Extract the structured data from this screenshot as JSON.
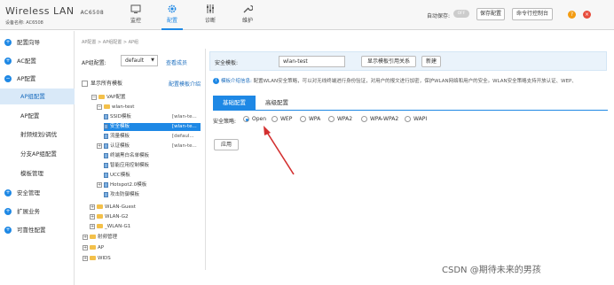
{
  "header": {
    "title": "Wireless",
    "title_lan": "LAN",
    "model": "AC6508",
    "device_label": "设备名称:",
    "device_name": "AC6508",
    "nav": [
      {
        "label": "监控",
        "icon": "monitor-icon",
        "active": false
      },
      {
        "label": "配置",
        "icon": "gear-icon",
        "active": true
      },
      {
        "label": "诊断",
        "icon": "sliders-icon",
        "active": false
      },
      {
        "label": "维护",
        "icon": "wrench-icon",
        "active": false
      }
    ],
    "autosave_label": "自动保存:",
    "autosave_state": "OFF",
    "save_button": "保存配置",
    "cli_button": "命令行控制台",
    "help_icon": "?",
    "close_icon": "×"
  },
  "sidebar": {
    "items": [
      {
        "label": "配置向导",
        "type": "group"
      },
      {
        "label": "AC配置",
        "type": "group"
      },
      {
        "label": "AP配置",
        "type": "group"
      },
      {
        "label": "AP组配置",
        "type": "sub",
        "active": true
      },
      {
        "label": "AP配置",
        "type": "sub"
      },
      {
        "label": "射频规划/调优",
        "type": "sub"
      },
      {
        "label": "分支AP组配置",
        "type": "sub"
      },
      {
        "label": "模板管理",
        "type": "sub"
      },
      {
        "label": "安全管理",
        "type": "group"
      },
      {
        "label": "扩展业务",
        "type": "group"
      },
      {
        "label": "可靠性配置",
        "type": "group"
      }
    ]
  },
  "breadcrumb": "AP配置 > AP组配置 > AP组",
  "tree_panel": {
    "apgroup_label": "AP组配置:",
    "apgroup_value": "default",
    "view_members_link": "查看成员",
    "show_all_label": "显示所有模板",
    "template_intro_link": "配置模板介绍",
    "rows": [
      {
        "text": "VAP配置",
        "kind": "folder",
        "toggle": "−"
      },
      {
        "text": "wlan-test",
        "kind": "folder",
        "toggle": "−"
      },
      {
        "text": "SSID模板",
        "kind": "item",
        "tag": "[wlan-te..."
      },
      {
        "text": "安全模板",
        "kind": "item",
        "tag": "[wlan-te...",
        "selected": true
      },
      {
        "text": "流量模板",
        "kind": "item",
        "tag": "[defaul..."
      },
      {
        "text": "认证模板",
        "kind": "item",
        "tag": "[wlan-te...",
        "toggle": "+"
      },
      {
        "text": "终端黑白名单模板",
        "kind": "item"
      },
      {
        "text": "智能应用控制模板",
        "kind": "item"
      },
      {
        "text": "UCC模板",
        "kind": "item"
      },
      {
        "text": "Hotspot2.0模板",
        "kind": "item",
        "toggle": "+"
      },
      {
        "text": "攻击防御模板",
        "kind": "item"
      },
      {
        "text": "WLAN-Guest",
        "kind": "folder",
        "toggle": "+"
      },
      {
        "text": "WLAN-G2",
        "kind": "folder",
        "toggle": "+"
      },
      {
        "text": "_WLAN-G1",
        "kind": "folder",
        "toggle": "+"
      },
      {
        "text": "射频管理",
        "kind": "folder",
        "toggle": "+"
      },
      {
        "text": "AP",
        "kind": "folder",
        "toggle": "+"
      },
      {
        "text": "WIDS",
        "kind": "folder",
        "toggle": "+"
      }
    ]
  },
  "content": {
    "template_label": "安全模板:",
    "template_value": "wlan-test",
    "show_ref_button": "显示模板引用关系",
    "new_button": "新建",
    "info_title": "模板介绍信息:",
    "info_text": " 配置WLAN安全策略，可以对无线终端进行身份验证，对用户的报文进行加密，保护WLAN网络和用户的安全。WLAN安全策略支持开放认证、WEP、",
    "tabs": [
      {
        "label": "基础配置",
        "active": true
      },
      {
        "label": "高级配置",
        "active": false
      }
    ],
    "policy_label": "安全策略:",
    "policies": [
      {
        "label": "Open",
        "checked": true
      },
      {
        "label": "WEP",
        "checked": false
      },
      {
        "label": "WPA",
        "checked": false
      },
      {
        "label": "WPA2",
        "checked": false
      },
      {
        "label": "WPA-WPA2",
        "checked": false
      },
      {
        "label": "WAPI",
        "checked": false
      }
    ],
    "apply_button": "应用"
  },
  "watermark": "CSDN @期待未来的男孩",
  "colors": {
    "accent": "#1e88e5",
    "annotation_arrow": "#d32f2f"
  }
}
